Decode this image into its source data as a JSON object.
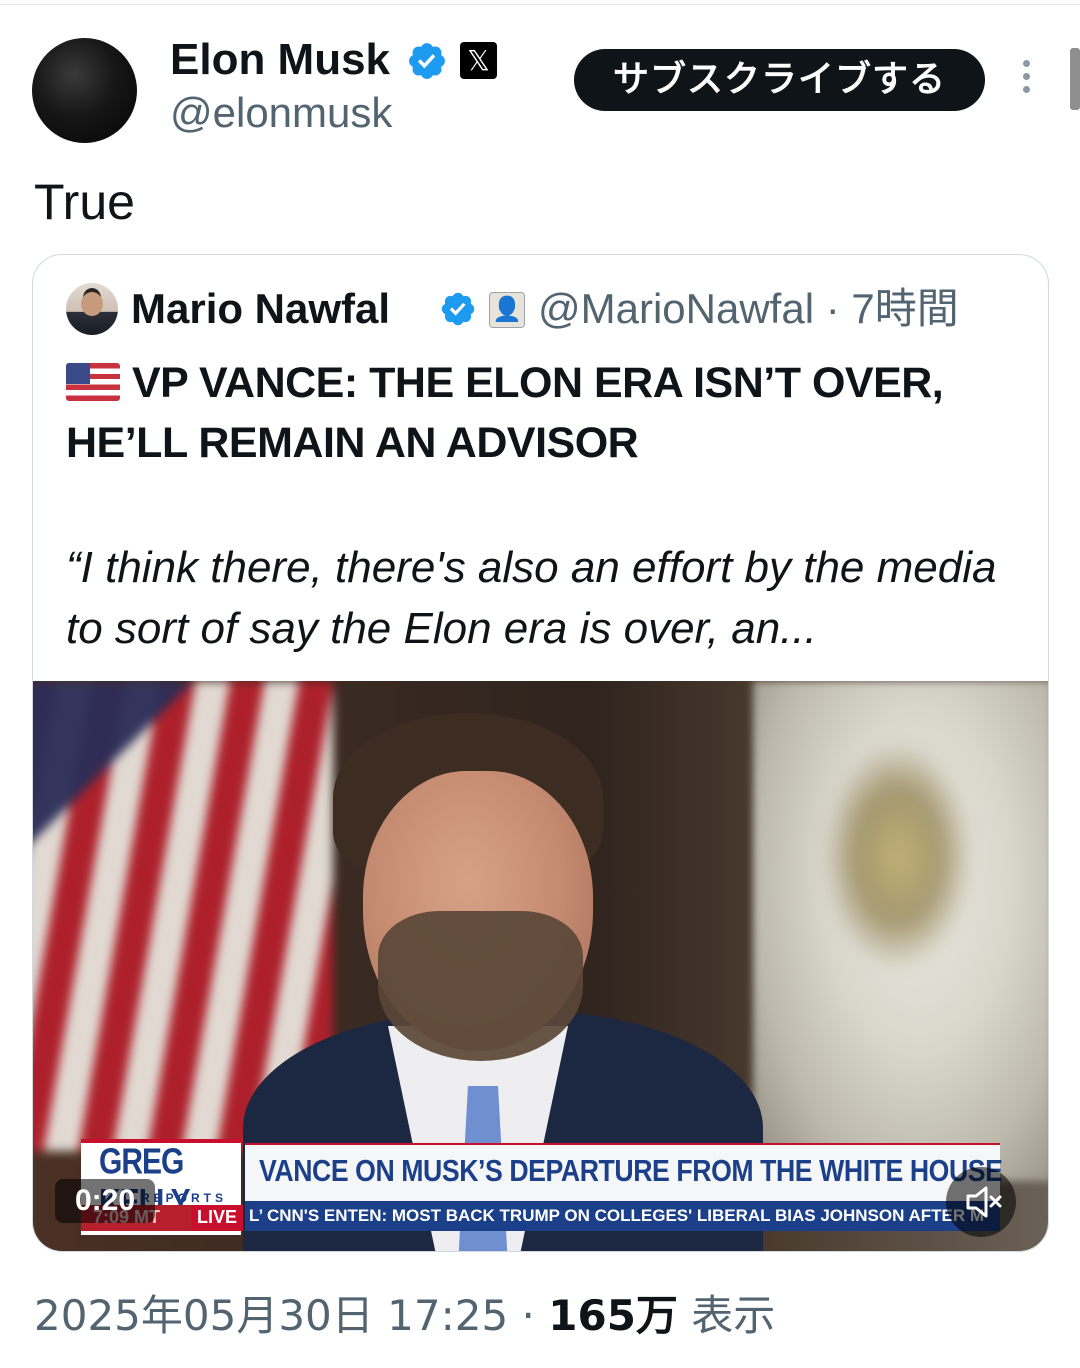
{
  "author": {
    "name": "Elon Musk",
    "handle": "@elonmusk",
    "x_badge": "𝕏",
    "subscribe_label": "サブスクライブする"
  },
  "tweet": {
    "text": "True"
  },
  "quoted": {
    "name": "Mario Nawfal",
    "handle": "@MarioNawfal",
    "separator": "·",
    "time": "7時間",
    "headline": "VP VANCE: THE ELON ERA ISN’T OVER, HE’LL REMAIN AN ADVISOR",
    "quote": "“I think there, there's also an effort by the media to sort of say the Elon era is over, an..."
  },
  "video": {
    "duration": "0:20",
    "lower_third": {
      "logo": "GREG KELLY",
      "logo_sub": "REPORTS",
      "headline": "VANCE ON MUSK’S DEPARTURE FROM THE WHITE HOUSE",
      "time": "7:09 MT",
      "live": "LIVE",
      "ticker": "L’     CNN'S ENTEN: MOST BACK TRUMP ON COLLEGES' LIBERAL BIAS      JOHNSON AFTER M"
    }
  },
  "footer": {
    "datetime": "2025年05月30日 17:25",
    "separator": "·",
    "views": "165万",
    "views_label": "表示"
  },
  "colors": {
    "verified": "#1d9bf0",
    "text_primary": "#0f1419",
    "text_secondary": "#536471",
    "border": "#cfd9de"
  },
  "icons": [
    "verified-badge-icon",
    "x-logo-icon",
    "more-options-icon",
    "us-flag-icon",
    "mute-icon"
  ]
}
